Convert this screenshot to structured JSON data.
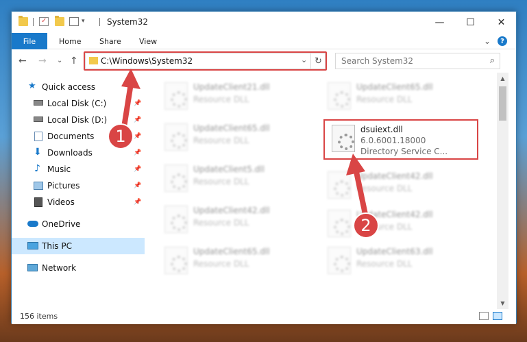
{
  "window": {
    "title": "System32",
    "controls": {
      "minimize": "—",
      "maximize": "☐",
      "close": "✕"
    }
  },
  "ribbon": {
    "tabs": [
      "File",
      "Home",
      "Share",
      "View"
    ],
    "expand_glyph": "⌄",
    "help_glyph": "?"
  },
  "address": {
    "path": "C:\\Windows\\System32",
    "dropdown_glyph": "⌄",
    "refresh_glyph": "↻"
  },
  "nav": {
    "back_glyph": "←",
    "forward_glyph": "→",
    "recent_glyph": "⌄",
    "up_glyph": "↑"
  },
  "search": {
    "placeholder": "Search System32",
    "icon": "search-icon"
  },
  "sidebar": {
    "items": [
      {
        "label": "Quick access",
        "icon": "star-icon",
        "pinned": false
      },
      {
        "label": "Local Disk (C:)",
        "icon": "drive-icon",
        "pinned": true
      },
      {
        "label": "Local Disk (D:)",
        "icon": "drive-icon",
        "pinned": true
      },
      {
        "label": "Documents",
        "icon": "documents-icon",
        "pinned": true
      },
      {
        "label": "Downloads",
        "icon": "download-icon",
        "pinned": true
      },
      {
        "label": "Music",
        "icon": "music-icon",
        "pinned": true
      },
      {
        "label": "Pictures",
        "icon": "pictures-icon",
        "pinned": true
      },
      {
        "label": "Videos",
        "icon": "videos-icon",
        "pinned": true
      },
      {
        "label": "OneDrive",
        "icon": "cloud-icon",
        "pinned": false
      },
      {
        "label": "This PC",
        "icon": "computer-icon",
        "pinned": false,
        "selected": true
      },
      {
        "label": "Network",
        "icon": "network-icon",
        "pinned": false
      }
    ],
    "pin_glyph": "📌"
  },
  "files": {
    "left": [
      {
        "name": "UpdateClient21.dll",
        "type": "Resource DLL"
      },
      {
        "name": "UpdateClient65.dll",
        "type": "Resource DLL"
      },
      {
        "name": "UpdateClient5.dll",
        "type": "Resource DLL"
      },
      {
        "name": "UpdateClient42.dll",
        "type": "Resource DLL"
      },
      {
        "name": "UpdateClient65.dll",
        "type": "Resource DLL"
      }
    ],
    "right": [
      {
        "name": "UpdateClient65.dll",
        "type": "Resource DLL"
      },
      {
        "name": "UpdateClient42.dll",
        "type": "Resource DLL"
      },
      {
        "name": "UpdateClient42.dll",
        "type": "Resource DLL"
      },
      {
        "name": "UpdateClient63.dll",
        "type": "Resource DLL"
      }
    ],
    "highlighted": {
      "name": "dsuiext.dll",
      "version": "6.0.6001.18000",
      "description": "Directory Service C..."
    }
  },
  "scrollbar": {
    "up_glyph": "▲",
    "down_glyph": "▼"
  },
  "status": {
    "item_count": "156 items"
  },
  "annotations": {
    "step1": "1",
    "step2": "2",
    "color": "#d94545"
  }
}
